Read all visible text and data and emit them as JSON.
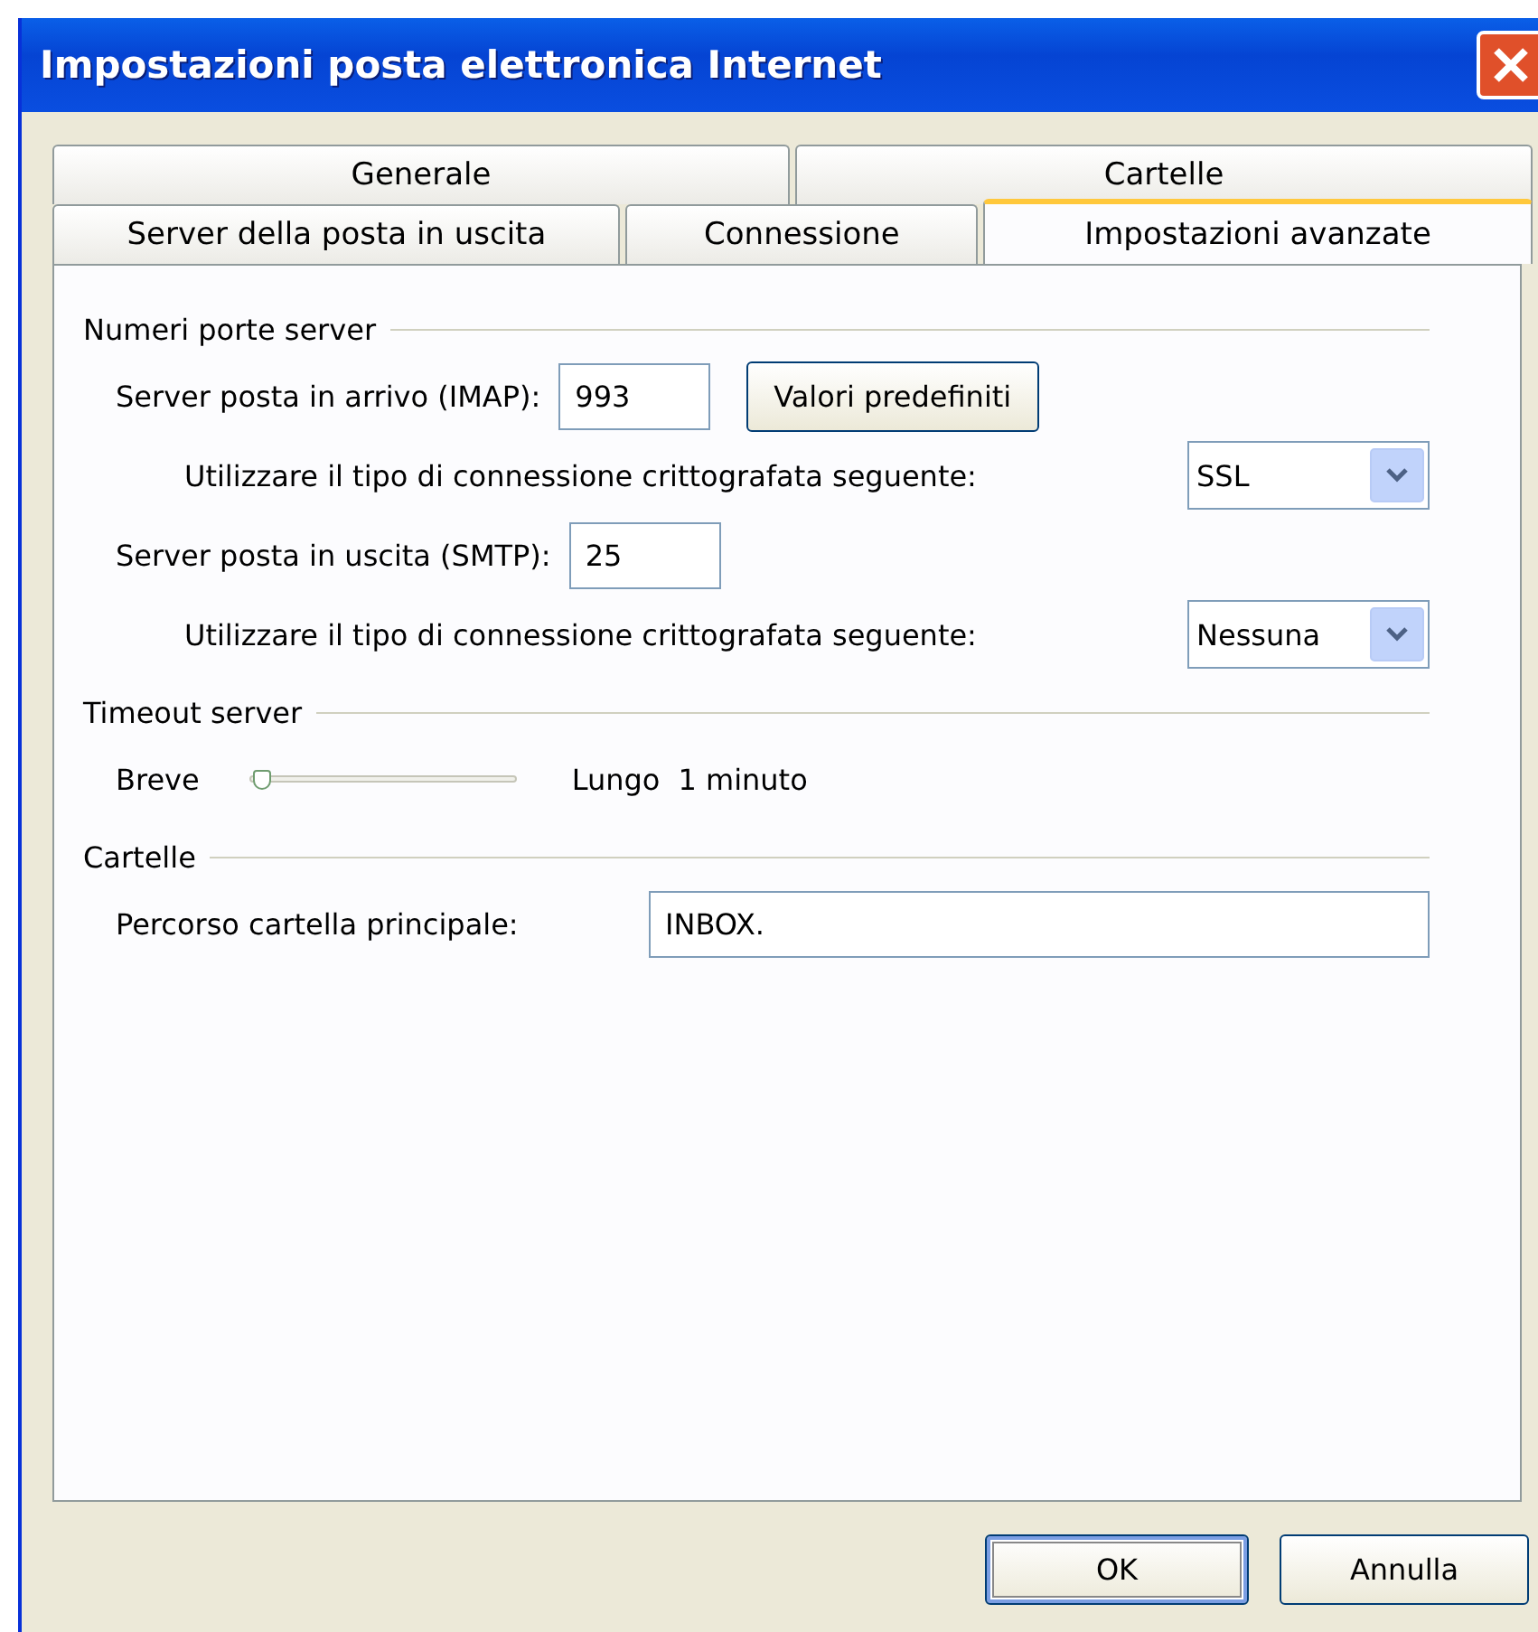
{
  "window": {
    "title": "Impostazioni posta elettronica Internet"
  },
  "tab_rows": [
    [
      {
        "label": "Generale",
        "selected": false
      },
      {
        "label": "Cartelle",
        "selected": false
      }
    ],
    [
      {
        "label": "Server della posta in uscita",
        "selected": false
      },
      {
        "label": "Connessione",
        "selected": false
      },
      {
        "label": "Impostazioni avanzate",
        "selected": true
      }
    ]
  ],
  "groups": [
    {
      "title": "Numeri porte server",
      "rows": [
        {
          "kind": "port",
          "label": "Server posta in arrivo (IMAP):",
          "value": "993",
          "button": "Valori predefiniti"
        },
        {
          "kind": "select",
          "label": "Utilizzare il tipo di connessione crittografata seguente:",
          "value": "SSL"
        },
        {
          "kind": "port",
          "label": "Server posta in uscita (SMTP):",
          "value": "25"
        },
        {
          "kind": "select",
          "label": "Utilizzare il tipo di connessione crittografata seguente:",
          "value": "Nessuna"
        }
      ]
    },
    {
      "title": "Timeout server",
      "rows": [
        {
          "kind": "slider",
          "label": "Breve",
          "end_label": "Lungo",
          "reading": "1 minuto",
          "level": 0.04
        }
      ]
    },
    {
      "title": "Cartelle",
      "rows": [
        {
          "kind": "path",
          "label": "Percorso cartella principale:",
          "value": "INBOX."
        }
      ]
    }
  ],
  "buttons": [
    {
      "label": "OK",
      "default": true
    },
    {
      "label": "Annulla",
      "default": false
    }
  ]
}
